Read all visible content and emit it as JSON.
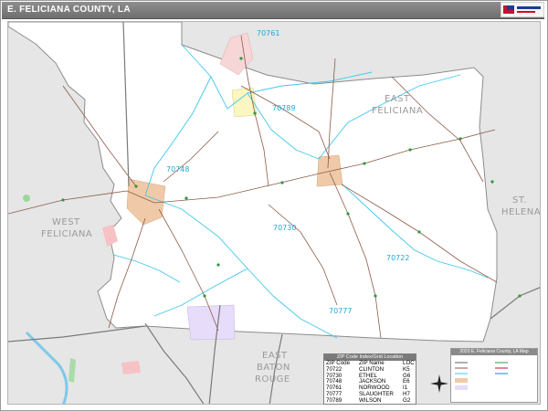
{
  "title": "E. FELICIANA COUNTY, LA",
  "logo": {
    "text": "Map Sherpa",
    "icon": "maps-logo"
  },
  "parishes": {
    "county": "EAST\nFELICIANA",
    "west": "WEST\nFELICIANA",
    "st_helena": "ST.\nHELENA",
    "east_baton_rouge": "EAST\nBATON\nROUGE"
  },
  "zip_labels": [
    "70761",
    "70789",
    "70748",
    "70730",
    "70722",
    "70777"
  ],
  "legend": {
    "header": "ZIP Code Index/Grid Location",
    "columns": [
      "ZIP Code",
      "ZIP Name",
      "LOC"
    ],
    "rows": [
      [
        "70722",
        "CLINTON",
        "K5"
      ],
      [
        "70730",
        "ETHEL",
        "G6"
      ],
      [
        "70748",
        "JACKSON",
        "E6"
      ],
      [
        "70761",
        "NORWOOD",
        "I1"
      ],
      [
        "70777",
        "SLAUGHTER",
        "H7"
      ],
      [
        "70789",
        "WILSON",
        "G2"
      ]
    ]
  },
  "key_box": {
    "header": "2020 E. Feliciana County, LA Map"
  },
  "colors": {
    "zip_boundary": "#3fc7ea",
    "roads": "#8b5a4a",
    "highway": "#7a7a7a",
    "outside": "#e6e6e6"
  }
}
